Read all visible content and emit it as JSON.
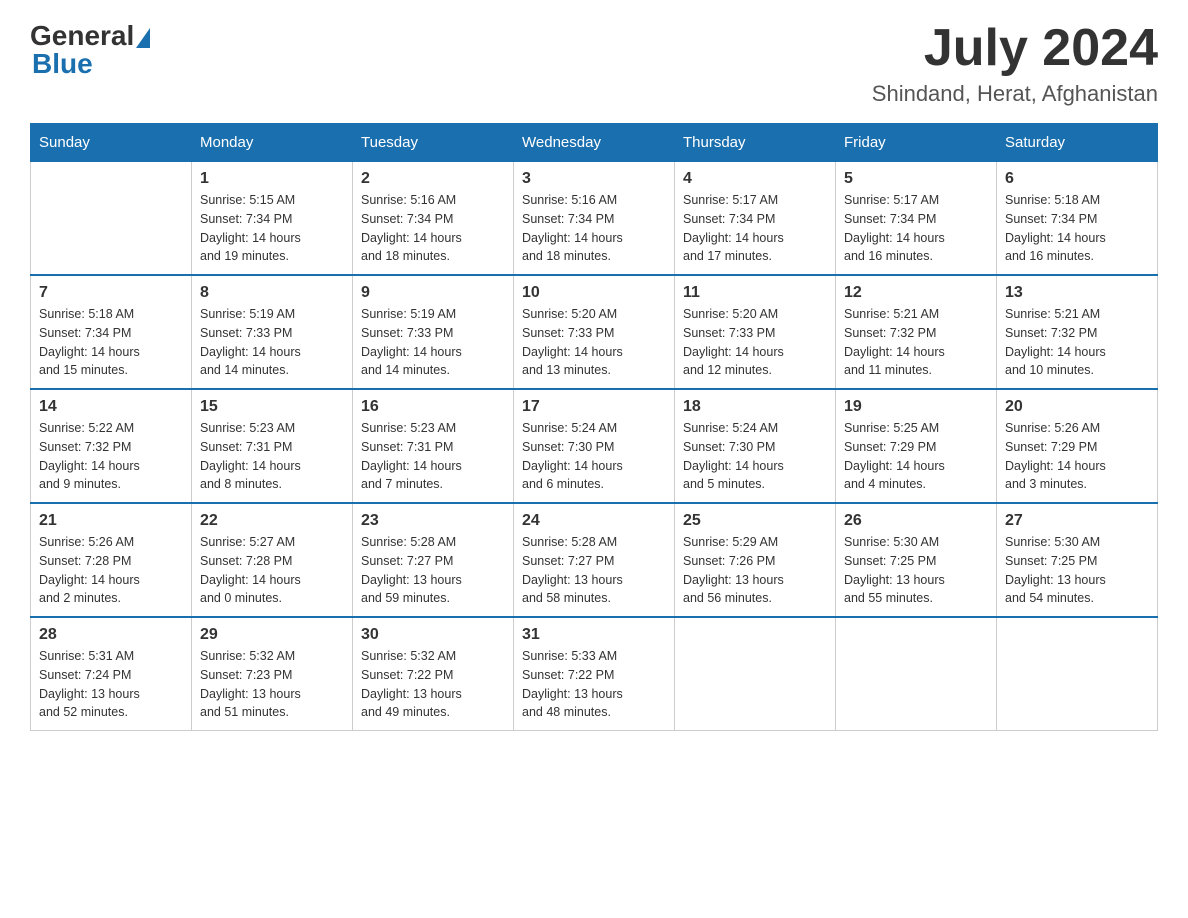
{
  "logo": {
    "general": "General",
    "blue": "Blue"
  },
  "title": {
    "month_year": "July 2024",
    "location": "Shindand, Herat, Afghanistan"
  },
  "days_of_week": [
    "Sunday",
    "Monday",
    "Tuesday",
    "Wednesday",
    "Thursday",
    "Friday",
    "Saturday"
  ],
  "weeks": [
    [
      {
        "day": "",
        "info": ""
      },
      {
        "day": "1",
        "info": "Sunrise: 5:15 AM\nSunset: 7:34 PM\nDaylight: 14 hours\nand 19 minutes."
      },
      {
        "day": "2",
        "info": "Sunrise: 5:16 AM\nSunset: 7:34 PM\nDaylight: 14 hours\nand 18 minutes."
      },
      {
        "day": "3",
        "info": "Sunrise: 5:16 AM\nSunset: 7:34 PM\nDaylight: 14 hours\nand 18 minutes."
      },
      {
        "day": "4",
        "info": "Sunrise: 5:17 AM\nSunset: 7:34 PM\nDaylight: 14 hours\nand 17 minutes."
      },
      {
        "day": "5",
        "info": "Sunrise: 5:17 AM\nSunset: 7:34 PM\nDaylight: 14 hours\nand 16 minutes."
      },
      {
        "day": "6",
        "info": "Sunrise: 5:18 AM\nSunset: 7:34 PM\nDaylight: 14 hours\nand 16 minutes."
      }
    ],
    [
      {
        "day": "7",
        "info": "Sunrise: 5:18 AM\nSunset: 7:34 PM\nDaylight: 14 hours\nand 15 minutes."
      },
      {
        "day": "8",
        "info": "Sunrise: 5:19 AM\nSunset: 7:33 PM\nDaylight: 14 hours\nand 14 minutes."
      },
      {
        "day": "9",
        "info": "Sunrise: 5:19 AM\nSunset: 7:33 PM\nDaylight: 14 hours\nand 14 minutes."
      },
      {
        "day": "10",
        "info": "Sunrise: 5:20 AM\nSunset: 7:33 PM\nDaylight: 14 hours\nand 13 minutes."
      },
      {
        "day": "11",
        "info": "Sunrise: 5:20 AM\nSunset: 7:33 PM\nDaylight: 14 hours\nand 12 minutes."
      },
      {
        "day": "12",
        "info": "Sunrise: 5:21 AM\nSunset: 7:32 PM\nDaylight: 14 hours\nand 11 minutes."
      },
      {
        "day": "13",
        "info": "Sunrise: 5:21 AM\nSunset: 7:32 PM\nDaylight: 14 hours\nand 10 minutes."
      }
    ],
    [
      {
        "day": "14",
        "info": "Sunrise: 5:22 AM\nSunset: 7:32 PM\nDaylight: 14 hours\nand 9 minutes."
      },
      {
        "day": "15",
        "info": "Sunrise: 5:23 AM\nSunset: 7:31 PM\nDaylight: 14 hours\nand 8 minutes."
      },
      {
        "day": "16",
        "info": "Sunrise: 5:23 AM\nSunset: 7:31 PM\nDaylight: 14 hours\nand 7 minutes."
      },
      {
        "day": "17",
        "info": "Sunrise: 5:24 AM\nSunset: 7:30 PM\nDaylight: 14 hours\nand 6 minutes."
      },
      {
        "day": "18",
        "info": "Sunrise: 5:24 AM\nSunset: 7:30 PM\nDaylight: 14 hours\nand 5 minutes."
      },
      {
        "day": "19",
        "info": "Sunrise: 5:25 AM\nSunset: 7:29 PM\nDaylight: 14 hours\nand 4 minutes."
      },
      {
        "day": "20",
        "info": "Sunrise: 5:26 AM\nSunset: 7:29 PM\nDaylight: 14 hours\nand 3 minutes."
      }
    ],
    [
      {
        "day": "21",
        "info": "Sunrise: 5:26 AM\nSunset: 7:28 PM\nDaylight: 14 hours\nand 2 minutes."
      },
      {
        "day": "22",
        "info": "Sunrise: 5:27 AM\nSunset: 7:28 PM\nDaylight: 14 hours\nand 0 minutes."
      },
      {
        "day": "23",
        "info": "Sunrise: 5:28 AM\nSunset: 7:27 PM\nDaylight: 13 hours\nand 59 minutes."
      },
      {
        "day": "24",
        "info": "Sunrise: 5:28 AM\nSunset: 7:27 PM\nDaylight: 13 hours\nand 58 minutes."
      },
      {
        "day": "25",
        "info": "Sunrise: 5:29 AM\nSunset: 7:26 PM\nDaylight: 13 hours\nand 56 minutes."
      },
      {
        "day": "26",
        "info": "Sunrise: 5:30 AM\nSunset: 7:25 PM\nDaylight: 13 hours\nand 55 minutes."
      },
      {
        "day": "27",
        "info": "Sunrise: 5:30 AM\nSunset: 7:25 PM\nDaylight: 13 hours\nand 54 minutes."
      }
    ],
    [
      {
        "day": "28",
        "info": "Sunrise: 5:31 AM\nSunset: 7:24 PM\nDaylight: 13 hours\nand 52 minutes."
      },
      {
        "day": "29",
        "info": "Sunrise: 5:32 AM\nSunset: 7:23 PM\nDaylight: 13 hours\nand 51 minutes."
      },
      {
        "day": "30",
        "info": "Sunrise: 5:32 AM\nSunset: 7:22 PM\nDaylight: 13 hours\nand 49 minutes."
      },
      {
        "day": "31",
        "info": "Sunrise: 5:33 AM\nSunset: 7:22 PM\nDaylight: 13 hours\nand 48 minutes."
      },
      {
        "day": "",
        "info": ""
      },
      {
        "day": "",
        "info": ""
      },
      {
        "day": "",
        "info": ""
      }
    ]
  ]
}
